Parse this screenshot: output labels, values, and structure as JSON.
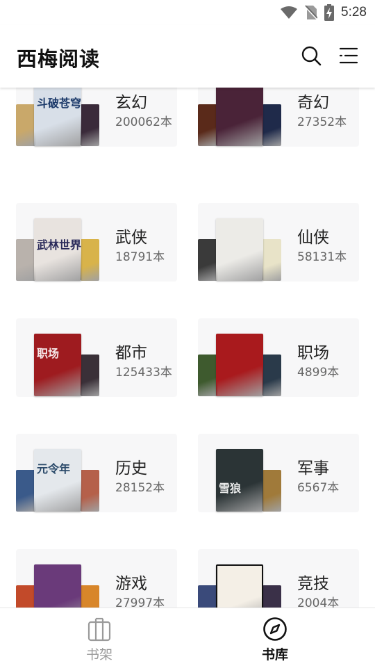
{
  "status": {
    "time": "5:28"
  },
  "app": {
    "title": "西梅阅读"
  },
  "categories": [
    {
      "name": "玄幻",
      "count": "200062本",
      "main_title": "斗破苍穹",
      "colors": {
        "main": "#d8dfe8",
        "left": "#c9a86a",
        "right": "#3a2a3a"
      }
    },
    {
      "name": "奇幻",
      "count": "27352本",
      "main_title": "",
      "colors": {
        "main": "#4a2338",
        "left": "#5a2a1a",
        "right": "#1f2a4a"
      }
    },
    {
      "name": "武侠",
      "count": "18791本",
      "main_title": "武林世界",
      "colors": {
        "main": "#e8e3df",
        "left": "#b9b2ac",
        "right": "#d8b34a"
      }
    },
    {
      "name": "仙侠",
      "count": "58131本",
      "main_title": "",
      "colors": {
        "main": "#ecebe7",
        "left": "#3a3a3a",
        "right": "#e8e3c8"
      }
    },
    {
      "name": "都市",
      "count": "125433本",
      "main_title": "职场",
      "colors": {
        "main": "#9e1b1f",
        "left": "#f7f7f8",
        "right": "#3a3038"
      }
    },
    {
      "name": "职场",
      "count": "4899本",
      "main_title": "",
      "colors": {
        "main": "#a91a1d",
        "left": "#3e5a2e",
        "right": "#2a3a4a"
      }
    },
    {
      "name": "历史",
      "count": "28152本",
      "main_title": "元令年",
      "colors": {
        "main": "#e4e8ec",
        "left": "#3a5a8a",
        "right": "#b5604a"
      }
    },
    {
      "name": "军事",
      "count": "6567本",
      "main_title": "雪狼",
      "colors": {
        "main": "#2b3436",
        "left": "#f7f7f8",
        "right": "#a07a3a"
      }
    },
    {
      "name": "游戏",
      "count": "27997本",
      "main_title": "",
      "colors": {
        "main": "#6a3a7a",
        "left": "#c24a2a",
        "right": "#d8862a"
      }
    },
    {
      "name": "竞技",
      "count": "2004本",
      "main_title": "",
      "colors": {
        "main": "#f4efe6",
        "left": "#3a4a7a",
        "right": "#3a3048"
      }
    }
  ],
  "nav": {
    "bookshelf": "书架",
    "library": "书库"
  },
  "theme": {
    "active": "#111111",
    "inactive": "#9a9a9a"
  }
}
